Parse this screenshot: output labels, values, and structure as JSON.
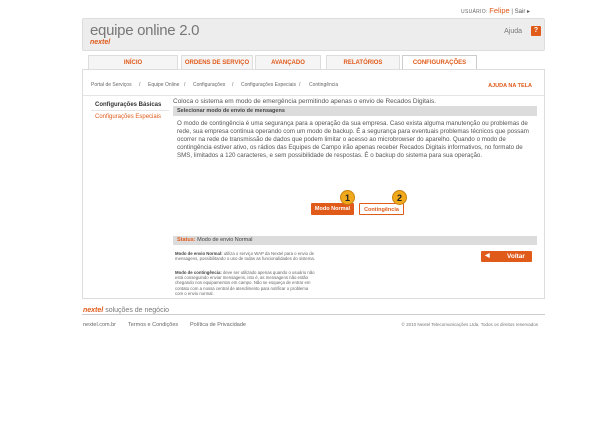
{
  "user_bar": {
    "label": "USUÁRIO:",
    "name": "Felipe",
    "separator": "|",
    "logout": "Sair ▸"
  },
  "header": {
    "title": "equipe online 2.0",
    "brand": "nextel",
    "help_label": "Ajuda",
    "help_icon": "?"
  },
  "tabs": [
    {
      "label": "INÍCIO",
      "active": false
    },
    {
      "label": "ORDENS DE SERVIÇO",
      "active": false
    },
    {
      "label": "AVANÇADO",
      "active": false
    },
    {
      "label": "RELATÓRIOS",
      "active": false
    },
    {
      "label": "CONFIGURAÇÕES",
      "active": true
    }
  ],
  "breadcrumb": [
    "Portal de Serviços",
    "Equipe Online",
    "Configurações",
    "Configurações Especiais",
    "Contingência"
  ],
  "breadcrumb_sep": "/",
  "help_screen": "AJUDA NA TELA",
  "sidebar": [
    {
      "label": "Configurações Básicas",
      "active": true
    },
    {
      "label": "Configurações Especiais",
      "active": false
    }
  ],
  "content": {
    "intro": "Coloca o sistema em modo de emergência permitindo apenas o envio de Recados Digitais.",
    "section_title": "Selecionar modo de envio de mensagens",
    "body": "O modo de contingência é uma segurança para a operação da sua empresa. Caso exista alguma manutenção ou problemas de rede, sua empresa continua operando com um modo de backup. É a segurança para eventuais problemas técnicos que possam ocorrer na rede de transmissão de dados que podem limitar o acesso ao microbrowser do aparelho. Quando o modo de contingência estiver ativo, os rádios das Equipes de Campo irão apenas receber Recados Digitais informativos, no formato de SMS, limitados a 120 caracteres, e sem possibilidade de respostas. É o backup do sistema para sua operação.",
    "btn_normal": "Modo Normal",
    "btn_contingencia": "Contingência",
    "marker_1": "1",
    "marker_2": "2",
    "status_label": "Status:",
    "status_value": "Modo de envio Normal",
    "help_normal_title": "Modo de envio Normal:",
    "help_normal_text": "utiliza o serviço WAP da Nextel para o envio de mensagens, possibilitando o uso de todas as funcionalidades do sistema.",
    "help_cont_title": "Modo de contingência:",
    "help_cont_text": "deve ser utilizado apenas quando o usuário não está conseguindo enviar mensagens, isto é, as mensagens não estão chegando nos equipamentos em campo. Não se esqueça de entrar em contato com a nossa central de atendimento para notificar o problema com o envio normal.",
    "back_button": "Voltar"
  },
  "footer": {
    "brand": "nextel",
    "brand_suffix": "soluções de negócio",
    "links": [
      "nextel.com.br",
      "Termos e Condições",
      "Política de Privacidade"
    ],
    "copyright": "© 2010 Nextel Telecomunicações Ltda. Todos os direitos reservados"
  },
  "colors": {
    "accent": "#e05a1a",
    "marker": "#f0a91a"
  }
}
